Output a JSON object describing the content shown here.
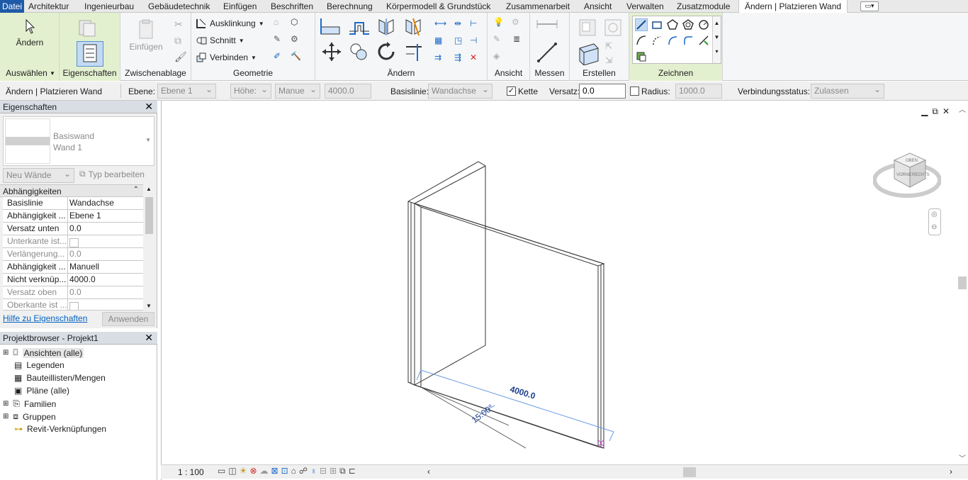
{
  "tabs": [
    "Datei",
    "Architektur",
    "Ingenieurbau",
    "Gebäudetechnik",
    "Einfügen",
    "Beschriften",
    "Berechnung",
    "Körpermodell & Grundstück",
    "Zusammenarbeit",
    "Ansicht",
    "Verwalten",
    "Zusatzmodule",
    "Ändern | Platzieren Wand"
  ],
  "ribbon": {
    "aendern_label": "Ändern",
    "auswaehlen_label": "Auswählen",
    "eigenschaften_label": "Eigenschaften",
    "einfuegen_label": "Einfügen",
    "zwischenablage_label": "Zwischenablage",
    "ausklinkung_label": "Ausklinkung",
    "schnitt_label": "Schnitt",
    "verbinden_label": "Verbinden",
    "geometrie_label": "Geometrie",
    "aendern_panel_label": "Ändern",
    "ansicht_label": "Ansicht",
    "messen_label": "Messen",
    "erstellen_label": "Erstellen",
    "zeichnen_label": "Zeichnen"
  },
  "options": {
    "context_title": "Ändern | Platzieren Wand",
    "ebene_label": "Ebene:",
    "ebene_value": "Ebene 1",
    "hoehe_label": "Höhe:",
    "manue_value": "Manue",
    "height_value": "4000.0",
    "basislinie_label": "Basislinie:",
    "basislinie_value": "Wandachse",
    "kette_label": "Kette",
    "versatz_label": "Versatz:",
    "versatz_value": "0.0",
    "radius_label": "Radius:",
    "radius_value": "1000.0",
    "verbindung_label": "Verbindungsstatus:",
    "verbindung_value": "Zulassen"
  },
  "properties": {
    "title": "Eigenschaften",
    "type_family": "Basiswand",
    "type_name": "Wand 1",
    "instance_filter": "Neu Wände",
    "edit_type": "Typ bearbeiten",
    "group": "Abhängigkeiten",
    "rows": [
      {
        "key": "Basislinie",
        "value": "Wandachse"
      },
      {
        "key": "Abhängigkeit ...",
        "value": "Ebene 1"
      },
      {
        "key": "Versatz unten",
        "value": "0.0"
      },
      {
        "key": "Unterkante ist...",
        "value": ""
      },
      {
        "key": "Verlängerung...",
        "value": "0.0"
      },
      {
        "key": "Abhängigkeit ...",
        "value": "Manuell"
      },
      {
        "key": "Nicht verknüp...",
        "value": "4000.0"
      },
      {
        "key": "Versatz oben",
        "value": "0.0"
      },
      {
        "key": "Oberkante ist ...",
        "value": ""
      }
    ],
    "help_link": "Hilfe zu Eigenschaften",
    "apply": "Anwenden"
  },
  "browser": {
    "title": "Projektbrowser - Projekt1",
    "items": [
      "Ansichten (alle)",
      "Legenden",
      "Bauteillisten/Mengen",
      "Pläne (alle)",
      "Familien",
      "Gruppen",
      "Revit-Verknüpfungen"
    ]
  },
  "view": {
    "length_dim": "4000.0",
    "angle_dim": "15.00°",
    "viewcube_top": "OBEN",
    "viewcube_front": "VORNE",
    "viewcube_right": "RECHTS"
  },
  "status": {
    "scale": "1 : 100"
  }
}
